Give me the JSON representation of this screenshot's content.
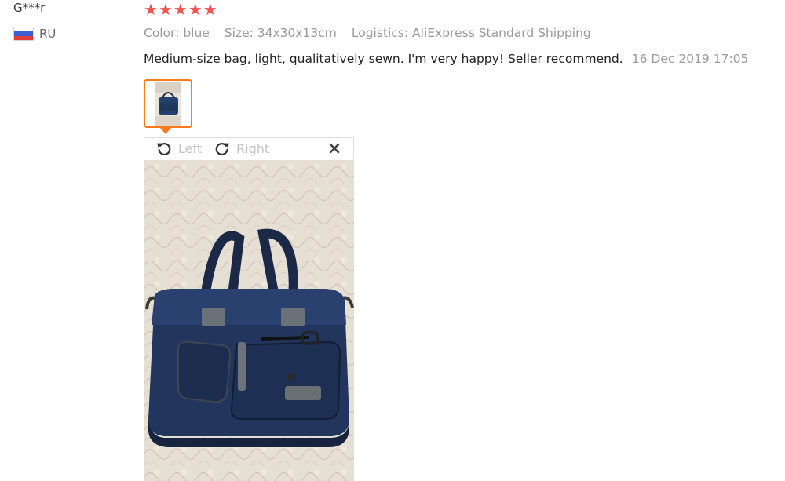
{
  "reviewer": {
    "name": "G***r",
    "country_code": "RU",
    "flag_icon": "russia-flag-icon"
  },
  "rating": {
    "stars": 5,
    "max": 5,
    "star_glyph": "★",
    "color": "#f65252"
  },
  "order_info": {
    "color": "Color: blue",
    "size": "Size: 34x30x13cm",
    "logistics": "Logistics: AliExpress Standard Shipping"
  },
  "review": {
    "text": "Medium-size bag, light, qualitatively sewn. I'm very happy! Seller recommend.",
    "date": "16 Dec 2019 17:05"
  },
  "viewer": {
    "rotate_left_label": "Left",
    "rotate_right_label": "Right",
    "accent_color": "#ff7a1a"
  }
}
